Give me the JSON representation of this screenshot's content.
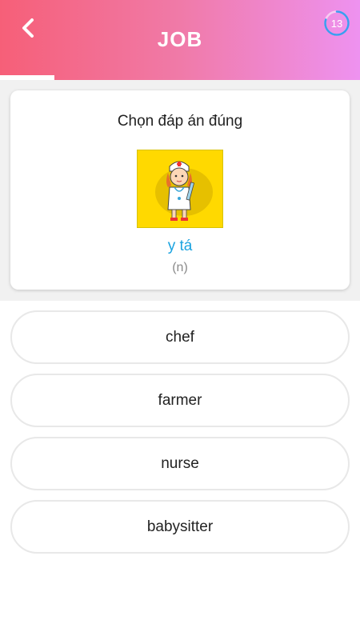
{
  "header": {
    "title": "JOB",
    "timer": 13,
    "progress": 0.15,
    "timer_fraction": 0.8
  },
  "question": {
    "prompt": "Chọn đáp án đúng",
    "word": "y tá",
    "part_of_speech": "(n)",
    "image_icon": "nurse-illustration"
  },
  "answers": [
    {
      "label": "chef"
    },
    {
      "label": "farmer"
    },
    {
      "label": "nurse"
    },
    {
      "label": "babysitter"
    }
  ],
  "colors": {
    "header_gradient": [
      "#f65f78",
      "#f07aa8",
      "#ee92f0"
    ],
    "word": "#1aa3e0",
    "timer_ring": "#3b9df0"
  }
}
